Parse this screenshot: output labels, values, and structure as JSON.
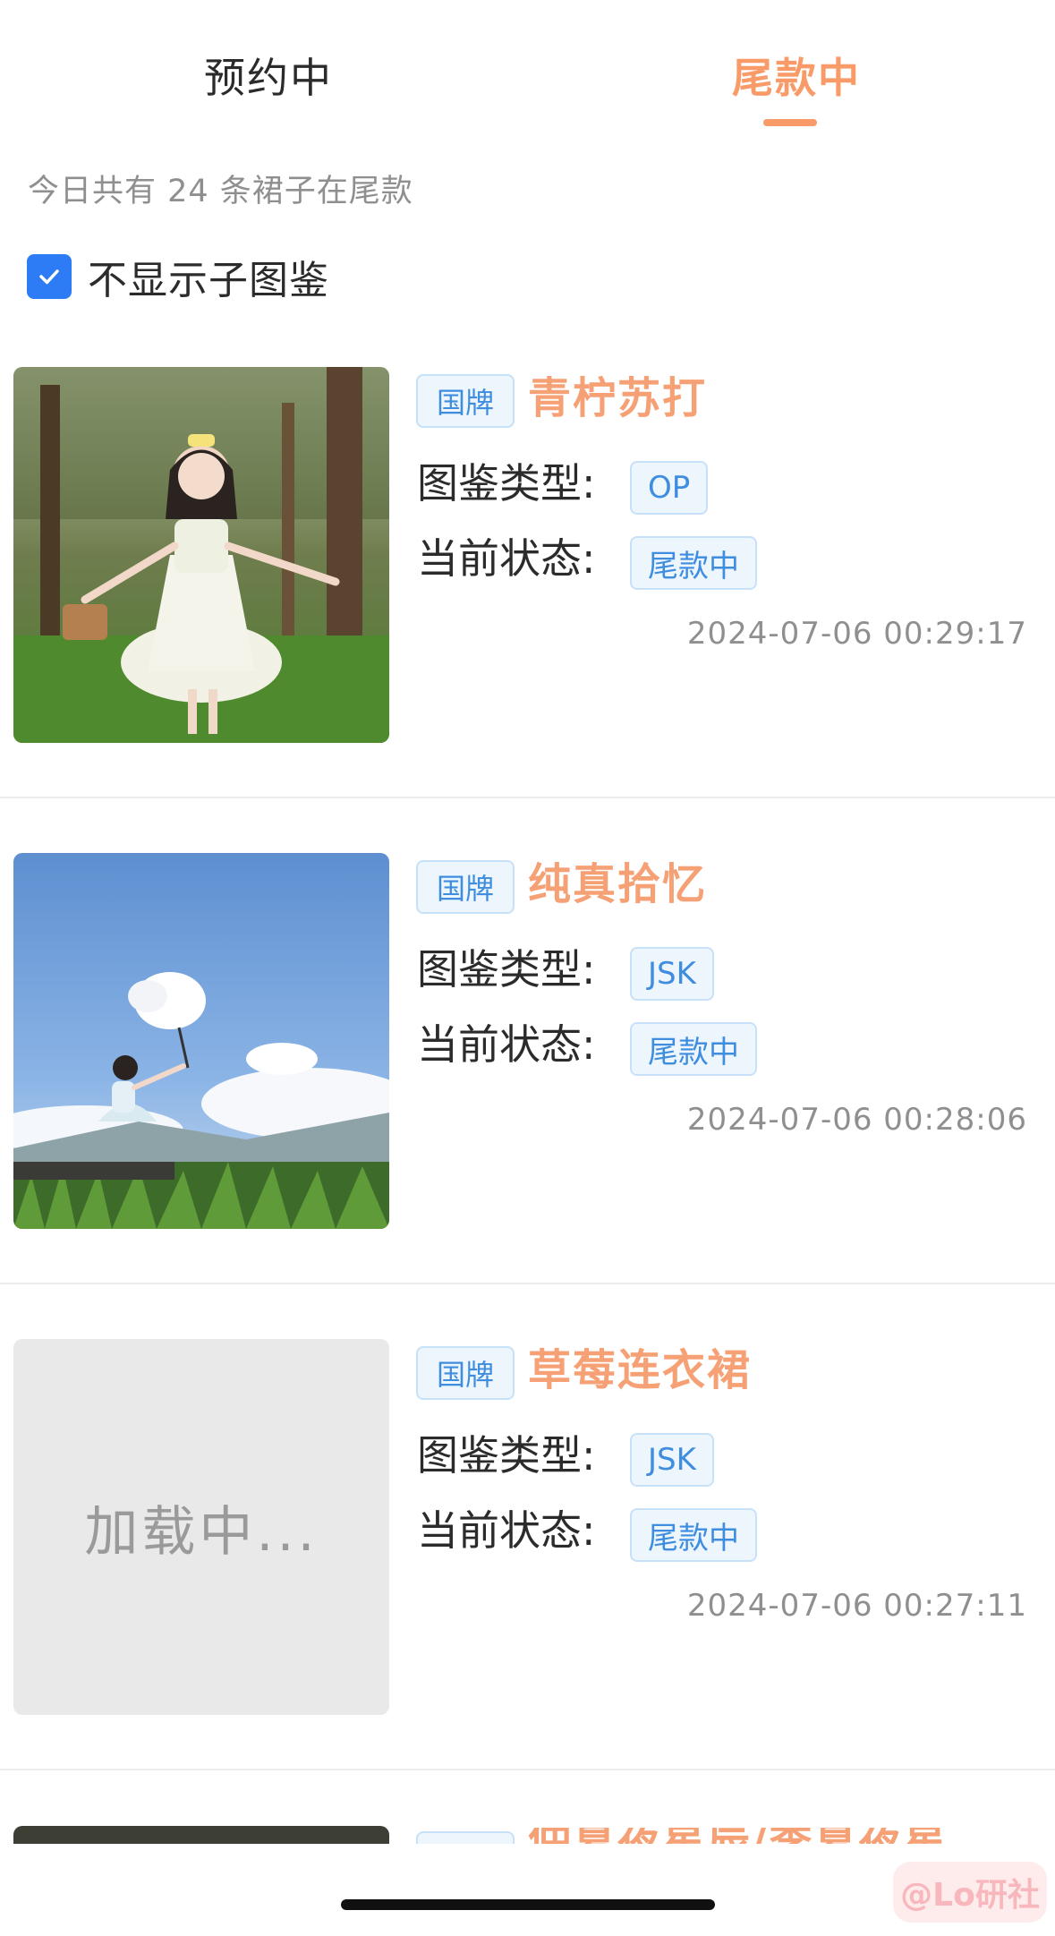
{
  "tabs": [
    {
      "label": "预约中",
      "active": false
    },
    {
      "label": "尾款中",
      "active": true
    }
  ],
  "summary": "今日共有 24 条裙子在尾款",
  "filter": {
    "label": "不显示子图鉴",
    "checked": true
  },
  "items": [
    {
      "brand_tag": "国牌",
      "title": "青柠苏打",
      "type_label": "图鉴类型:",
      "type_value": "OP",
      "status_label": "当前状态:",
      "status_value": "尾款中",
      "time": "2024-07-06 00:29:17",
      "image": "forest-girl-photo"
    },
    {
      "brand_tag": "国牌",
      "title": "纯真拾忆",
      "type_label": "图鉴类型:",
      "type_value": "JSK",
      "status_label": "当前状态:",
      "status_value": "尾款中",
      "time": "2024-07-06 00:28:06",
      "image": "sky-cloud-girl-photo"
    },
    {
      "brand_tag": "国牌",
      "title": "草莓连衣裙",
      "type_label": "图鉴类型:",
      "type_value": "JSK",
      "status_label": "当前状态:",
      "status_value": "尾款中",
      "time": "2024-07-06 00:27:11",
      "image_loading_text": "加载中..."
    }
  ],
  "partial_item": {
    "title": "仲夏夜星辰/季夏夜星辰"
  },
  "watermark": "@Lo研社",
  "colors": {
    "accent": "#f89b68",
    "tag_blue": "#3f8ddf",
    "checkbox": "#2d7cf6"
  }
}
